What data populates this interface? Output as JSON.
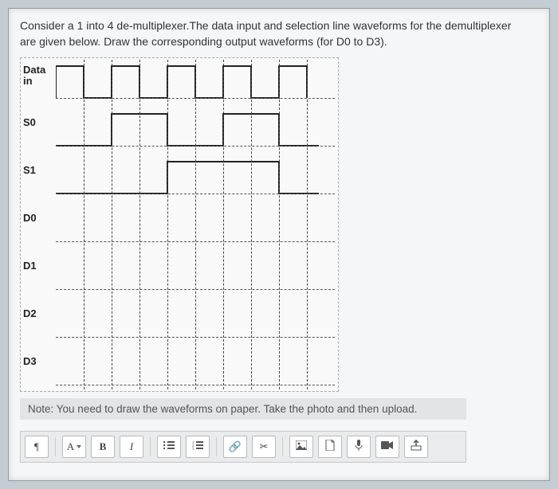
{
  "question": {
    "line1": "Consider a 1 into 4 de-multiplexer.The data input and selection line waveforms for the demultiplexer",
    "line2": "are given below. Draw the corresponding output waveforms (for D0 to D3)."
  },
  "signals": {
    "data_in": {
      "label": "Data\nin"
    },
    "s0": {
      "label": "S0"
    },
    "s1": {
      "label": "S1"
    },
    "d0": {
      "label": "D0"
    },
    "d1": {
      "label": "D1"
    },
    "d2": {
      "label": "D2"
    },
    "d3": {
      "label": "D3"
    }
  },
  "note": "Note: You need to draw the waveforms on paper. Take the photo and then upload.",
  "toolbar": {
    "paragraph": "¶",
    "font": "A",
    "bold": "B",
    "italic": "I"
  }
}
